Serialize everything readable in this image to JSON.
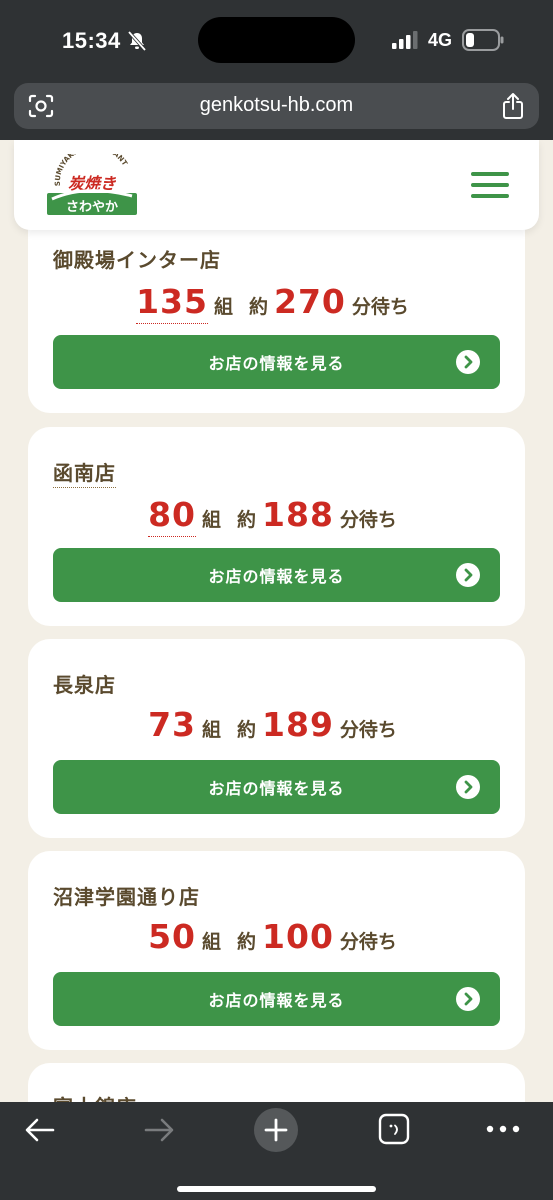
{
  "status_bar": {
    "time": "15:34",
    "network": "4G"
  },
  "url_bar": {
    "url": "genkotsu-hb.com"
  },
  "header": {
    "logo_lines": [
      "SUMIYAKI RESTAURANT",
      "炭焼き",
      "さわやか"
    ]
  },
  "stores": [
    {
      "name": "御殿場インター店",
      "groups": "135",
      "groups_unit": "組",
      "approx": "約",
      "minutes": "270",
      "minutes_unit": "分待ち",
      "button_label": "お店の情報を見る"
    },
    {
      "name": "函南店",
      "groups": "80",
      "groups_unit": "組",
      "approx": "約",
      "minutes": "188",
      "minutes_unit": "分待ち",
      "button_label": "お店の情報を見る"
    },
    {
      "name": "長泉店",
      "groups": "73",
      "groups_unit": "組",
      "approx": "約",
      "minutes": "189",
      "minutes_unit": "分待ち",
      "button_label": "お店の情報を見る"
    },
    {
      "name": "沼津学園通り店",
      "groups": "50",
      "groups_unit": "組",
      "approx": "約",
      "minutes": "100",
      "minutes_unit": "分待ち",
      "button_label": "お店の情報を見る"
    },
    {
      "name": "富士錦店"
    }
  ],
  "colors": {
    "brand_green": "#3e9448",
    "wait_red": "#cc2a22",
    "text_brown": "#5a4a2e",
    "page_bg": "#f3efe6"
  }
}
